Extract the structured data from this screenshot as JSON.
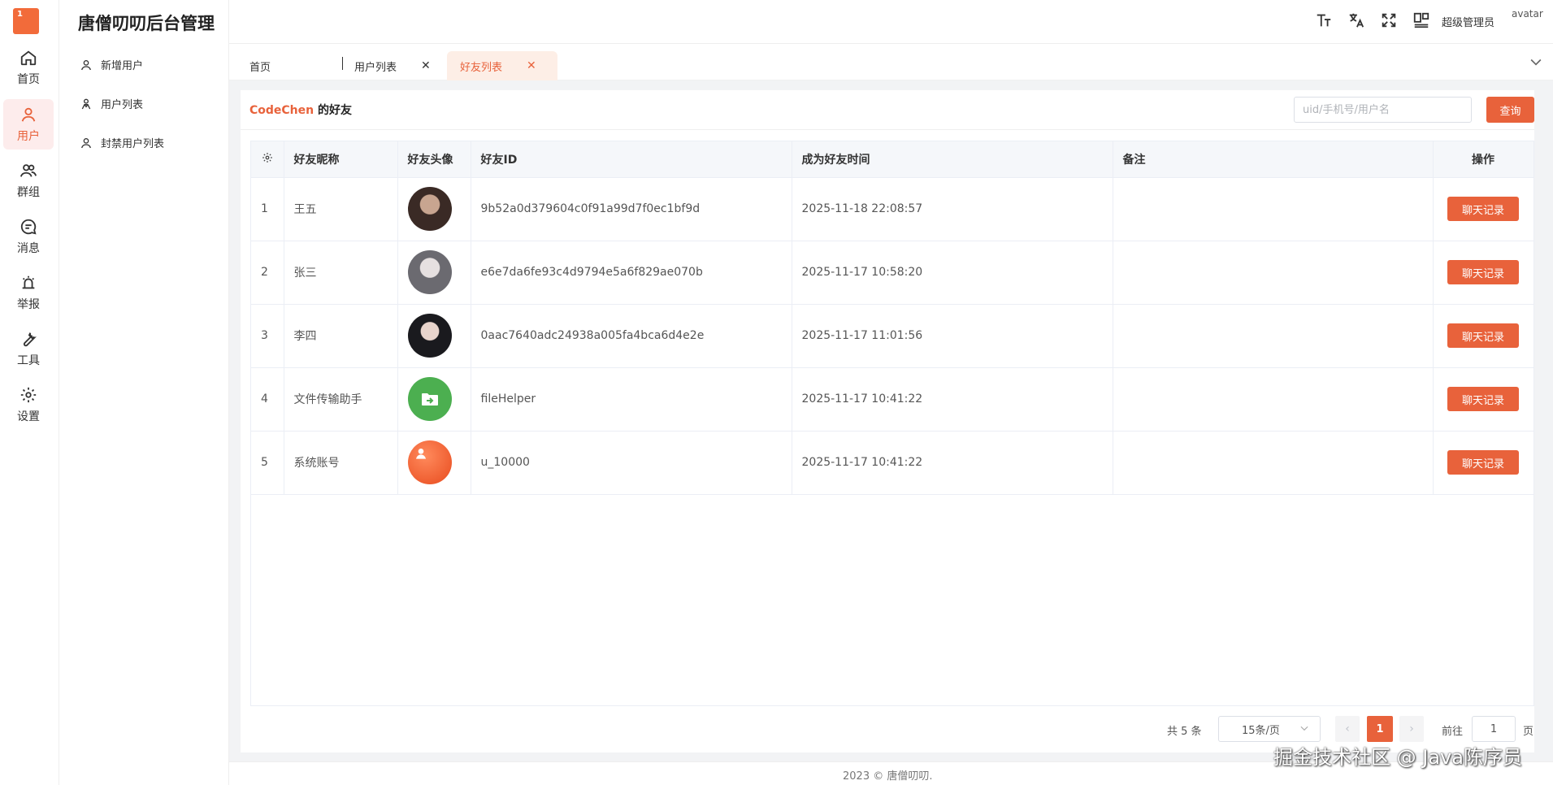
{
  "app": {
    "logo_text": "1",
    "title": "唐僧叨叨后台管理"
  },
  "rail": [
    {
      "label": "首页",
      "icon": "home-icon",
      "active": false
    },
    {
      "label": "用户",
      "icon": "user-icon",
      "active": true
    },
    {
      "label": "群组",
      "icon": "group-icon",
      "active": false
    },
    {
      "label": "消息",
      "icon": "message-icon",
      "active": false
    },
    {
      "label": "举报",
      "icon": "alarm-icon",
      "active": false
    },
    {
      "label": "工具",
      "icon": "wrench-icon",
      "active": false
    },
    {
      "label": "设置",
      "icon": "gear-icon",
      "active": false
    }
  ],
  "subnav": [
    {
      "label": "新增用户",
      "icon": "user-add-icon"
    },
    {
      "label": "用户列表",
      "icon": "users-list-icon"
    },
    {
      "label": "封禁用户列表",
      "icon": "user-ban-icon"
    }
  ],
  "header": {
    "icons": [
      "font-size-icon",
      "translate-icon",
      "fullscreen-icon",
      "layout-icon"
    ],
    "username": "超级管理员",
    "avatar_alt": "avatar"
  },
  "tabs": [
    {
      "label": "首页",
      "active": false,
      "closable": false
    },
    {
      "label": "用户列表",
      "active": false,
      "closable": true
    },
    {
      "label": "好友列表",
      "active": true,
      "closable": true
    }
  ],
  "page": {
    "title_name": "CodeChen",
    "title_suffix": " 的好友",
    "search_placeholder": "uid/手机号/用户名",
    "search_button": "查询"
  },
  "table": {
    "columns": [
      "好友昵称",
      "好友头像",
      "好友ID",
      "成为好友时间",
      "备注",
      "操作"
    ],
    "rows": [
      {
        "index": "1",
        "nickname": "王五",
        "avatar": "photo1",
        "friend_id": "9b52a0d379604c0f91a99d7f0ec1bf9d",
        "time": "2025-11-18 22:08:57",
        "remark": "",
        "action": "聊天记录"
      },
      {
        "index": "2",
        "nickname": "张三",
        "avatar": "photo2",
        "friend_id": "e6e7da6fe93c4d9794e5a6f829ae070b",
        "time": "2025-11-17 10:58:20",
        "remark": "",
        "action": "聊天记录"
      },
      {
        "index": "3",
        "nickname": "李四",
        "avatar": "photo3",
        "friend_id": "0aac7640adc24938a005fa4bca6d4e2e",
        "time": "2025-11-17 11:01:56",
        "remark": "",
        "action": "聊天记录"
      },
      {
        "index": "4",
        "nickname": "文件传输助手",
        "avatar": "file-helper",
        "friend_id": "fileHelper",
        "time": "2025-11-17 10:41:22",
        "remark": "",
        "action": "聊天记录"
      },
      {
        "index": "5",
        "nickname": "系统账号",
        "avatar": "system",
        "friend_id": "u_10000",
        "time": "2025-11-17 10:41:22",
        "remark": "",
        "action": "聊天记录"
      }
    ]
  },
  "pagination": {
    "total": "共 5 条",
    "page_size": "15条/页",
    "current": "1",
    "goto_label": "前往",
    "goto_value": "1",
    "page_label": "页"
  },
  "footer": "2023 © 唐僧叨叨.",
  "watermark": "掘金技术社区 @ Java陈序员",
  "colors": {
    "accent": "#e8623b",
    "accent_light": "#fdecec"
  }
}
